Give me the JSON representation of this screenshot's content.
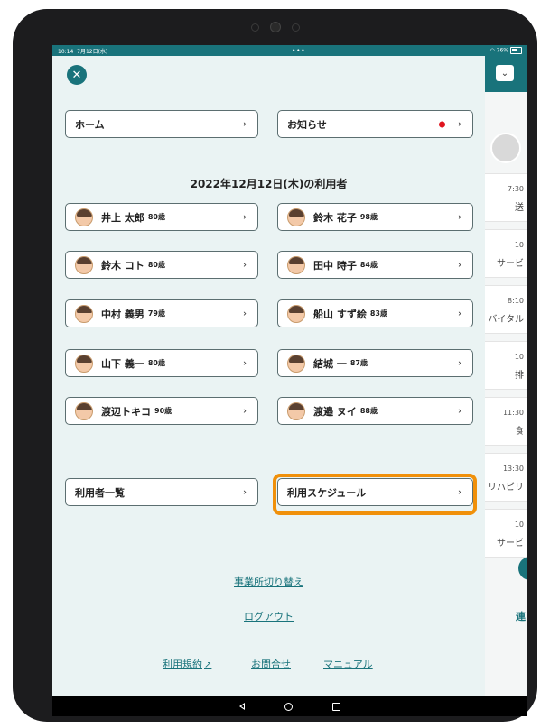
{
  "status_bar": {
    "time": "10:14",
    "date": "7月12日(水)",
    "dots": "•••",
    "battery": "76%"
  },
  "drawer": {
    "close_label": "✕",
    "home_label": "ホーム",
    "notice_label": "お知らせ",
    "section_title": "2022年12月12日(木)の利用者",
    "users": [
      {
        "name": "井上 太郎",
        "age": "80歳"
      },
      {
        "name": "鈴木 花子",
        "age": "98歳"
      },
      {
        "name": "鈴木 コト",
        "age": "80歳"
      },
      {
        "name": "田中 時子",
        "age": "84歳"
      },
      {
        "name": "中村 義男",
        "age": "79歳"
      },
      {
        "name": "船山 すず絵",
        "age": "83歳"
      },
      {
        "name": "山下 義一",
        "age": "80歳"
      },
      {
        "name": "結城 一",
        "age": "87歳"
      },
      {
        "name": "渡辺トキコ",
        "age": "90歳"
      },
      {
        "name": "渡邉 ヌイ",
        "age": "88歳"
      }
    ],
    "user_list_label": "利用者一覧",
    "schedule_label": "利用スケジュール",
    "switch_office_label": "事業所切り替え",
    "logout_label": "ログアウト",
    "terms_label": "利用規約",
    "contact_label": "お問合せ",
    "manual_label": "マニュアル",
    "chevron": "›"
  },
  "background": {
    "dropdown_chevron": "⌄",
    "cards": [
      {
        "time": "7:30",
        "label": "送"
      },
      {
        "time": "10",
        "label": "サービ"
      },
      {
        "time": "8:10",
        "label": "バイタル"
      },
      {
        "time": "10",
        "label": "排"
      },
      {
        "time": "11:30",
        "label": "食"
      },
      {
        "time": "13:30",
        "label": "リハビリ"
      },
      {
        "time": "10",
        "label": "サービ"
      }
    ],
    "link": "連"
  },
  "colors": {
    "primary": "#19737b",
    "highlight": "#f0900a",
    "notice_dot": "#e0141e"
  }
}
